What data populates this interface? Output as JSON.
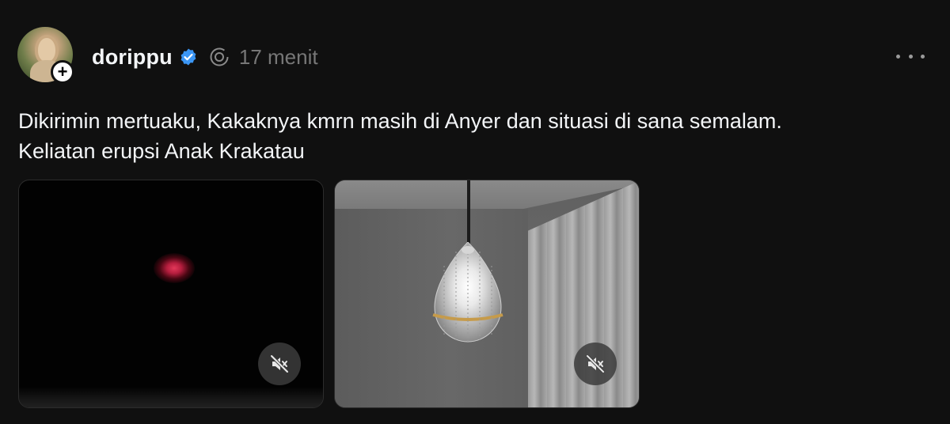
{
  "post": {
    "username": "dorippu",
    "time": "17 menit",
    "caption_lines": [
      "Dikirimin mertuaku, Kakaknya kmrn masih di Anyer dan situasi di sana semalam.",
      "Keliatan erupsi Anak Krakatau"
    ],
    "icons": {
      "follow": "plus-icon",
      "verified": "verified-badge-icon",
      "thread": "threads-reply-icon",
      "more": "more-horizontal-icon",
      "mute": "speaker-muted-icon"
    },
    "follow_symbol": "+",
    "media": [
      {
        "kind": "video",
        "muted": true
      },
      {
        "kind": "video",
        "muted": true
      }
    ]
  },
  "colors": {
    "background": "#101010",
    "text": "#f3f5f7",
    "muted_text": "#777777",
    "verified_blue": "#3b96f5"
  }
}
